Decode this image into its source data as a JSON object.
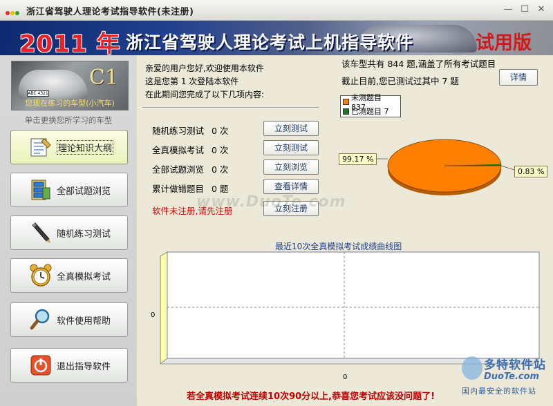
{
  "window": {
    "title": "浙江省驾驶人理论考试指导软件(未注册)"
  },
  "banner": {
    "year": "2011 年",
    "app_title": "浙江省驾驶人理论考试上机指导软件",
    "trial": "试用版"
  },
  "sidebar": {
    "car_class": "C1",
    "car_label": "您现在练习的车型(小汽车)",
    "plate_text": "ABC 4321",
    "change_hint": "单击更换您所学习的车型",
    "nav": [
      {
        "label": "理论知识大纲",
        "icon": "notebook-icon"
      },
      {
        "label": "全部试题浏览",
        "icon": "file-cabinet-icon"
      },
      {
        "label": "随机练习测试",
        "icon": "pen-icon"
      },
      {
        "label": "全真模拟考试",
        "icon": "alarm-clock-icon"
      },
      {
        "label": "软件使用帮助",
        "icon": "magnifier-icon"
      },
      {
        "label": "退出指导软件",
        "icon": "power-icon"
      }
    ]
  },
  "greeting": {
    "line1": "亲爱的用户您好,欢迎使用本软件",
    "line2": "这是您第  1  次登陆本软件",
    "line3": "在此期间您完成了以下几项内容:"
  },
  "stats": [
    {
      "label": "随机练习测试",
      "value": "0 次",
      "button": "立刻测试"
    },
    {
      "label": "全真模拟考试",
      "value": "0 次",
      "button": "立刻测试"
    },
    {
      "label": "全部试题浏览",
      "value": "0 次",
      "button": "立刻浏览"
    },
    {
      "label": "累计做错题目",
      "value": "0 题",
      "button": "查看详情"
    }
  ],
  "register": {
    "text": "软件未注册,请先注册",
    "button": "立刻注册"
  },
  "summary": {
    "line1": "该车型共有  844  题,涵盖了所有考试题目",
    "line2": "截止目前,您已测试过其中  7  题",
    "detail_button": "详情"
  },
  "pie": {
    "legend": [
      {
        "label": "未测题目 837",
        "color": "#ff7f00"
      },
      {
        "label": "已测题目 7",
        "color": "#1a7a1a"
      }
    ],
    "untested_pct_label": "99.17 %",
    "tested_pct_label": "0.83 %"
  },
  "chart_data": {
    "type": "line",
    "title": "最近10次全真模拟考试成绩曲线图",
    "x": [],
    "series": [],
    "xlabel": "",
    "ylabel": "",
    "x_tick_labels": [
      "0"
    ],
    "y_tick_labels": [
      "0"
    ],
    "grid": true
  },
  "footer": {
    "note": "若全真模拟考试连续10次90分以上,恭喜您考试应该没问题了!"
  },
  "watermark": "www.DuoTe.com",
  "logo": {
    "name": "多特软件站",
    "domain": "DuoTe.com",
    "tagline": "国内最安全的软件站"
  }
}
